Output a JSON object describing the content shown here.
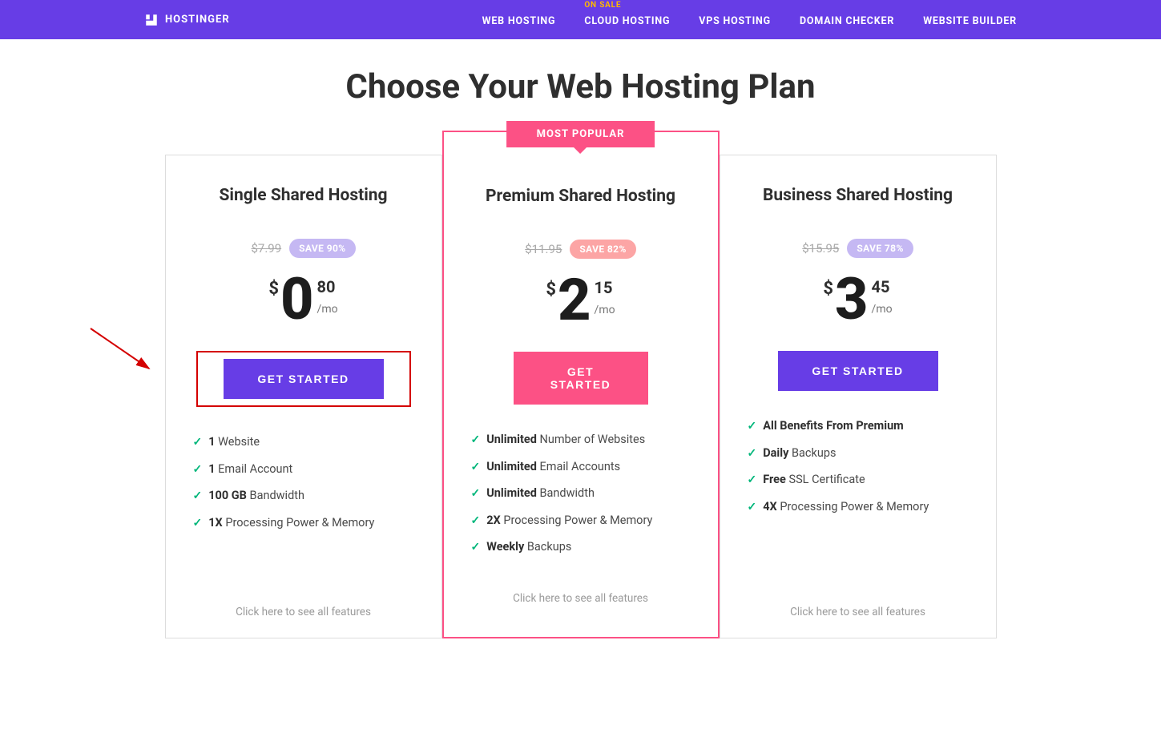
{
  "header": {
    "brand": "HOSTINGER",
    "nav": [
      {
        "label": "WEB HOSTING",
        "on_sale": null
      },
      {
        "label": "CLOUD HOSTING",
        "on_sale": "ON SALE"
      },
      {
        "label": "VPS HOSTING",
        "on_sale": null
      },
      {
        "label": "DOMAIN CHECKER",
        "on_sale": null
      },
      {
        "label": "WEBSITE BUILDER",
        "on_sale": null
      }
    ]
  },
  "page_title": "Choose Your Web Hosting Plan",
  "popular_label": "MOST POPULAR",
  "per_month": "/mo",
  "see_all": "Click here to see all features",
  "plans": [
    {
      "name": "Single Shared Hosting",
      "old_price": "$7.99",
      "save": "SAVE 90%",
      "currency": "$",
      "whole": "0",
      "cents": "80",
      "cta": "GET STARTED",
      "features": [
        {
          "bold": "1",
          "rest": " Website"
        },
        {
          "bold": "1",
          "rest": " Email Account"
        },
        {
          "bold": "100 GB",
          "rest": " Bandwidth"
        },
        {
          "bold": "1X",
          "rest": " Processing Power & Memory"
        }
      ]
    },
    {
      "name": "Premium Shared Hosting",
      "old_price": "$11.95",
      "save": "SAVE 82%",
      "currency": "$",
      "whole": "2",
      "cents": "15",
      "cta": "GET STARTED",
      "features": [
        {
          "bold": "Unlimited",
          "rest": " Number of Websites"
        },
        {
          "bold": "Unlimited",
          "rest": " Email Accounts"
        },
        {
          "bold": "Unlimited",
          "rest": " Bandwidth"
        },
        {
          "bold": "2X",
          "rest": " Processing Power & Memory"
        },
        {
          "bold": "Weekly",
          "rest": " Backups"
        }
      ]
    },
    {
      "name": "Business Shared Hosting",
      "old_price": "$15.95",
      "save": "SAVE 78%",
      "currency": "$",
      "whole": "3",
      "cents": "45",
      "cta": "GET STARTED",
      "features": [
        {
          "bold": "All Benefits From Premium",
          "rest": ""
        },
        {
          "bold": "Daily",
          "rest": " Backups"
        },
        {
          "bold": "Free",
          "rest": " SSL Certificate"
        },
        {
          "bold": "4X",
          "rest": " Processing Power & Memory"
        }
      ]
    }
  ]
}
